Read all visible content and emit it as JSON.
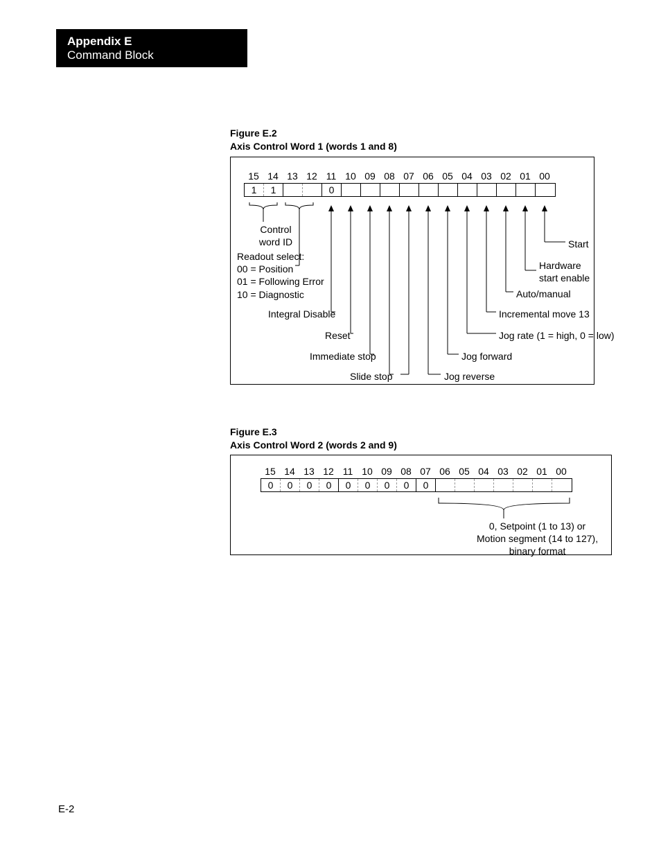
{
  "header": {
    "appendix": "Appendix E",
    "section": "Command Block"
  },
  "page_number": "E-2",
  "figE2": {
    "name": "Figure E.2",
    "title": "Axis Control Word 1 (words 1 and 8)",
    "bits": [
      "15",
      "14",
      "13",
      "12",
      "11",
      "10",
      "09",
      "08",
      "07",
      "06",
      "05",
      "04",
      "03",
      "02",
      "01",
      "00"
    ],
    "values": [
      "1",
      "1",
      "",
      "",
      "0",
      "",
      "",
      "",
      "",
      "",
      "",
      "",
      "",
      "",
      "",
      ""
    ],
    "labels": {
      "control_word_id": "Control\nword ID",
      "readout_select_title": "Readout select:",
      "readout_select_00": "00 = Position",
      "readout_select_01": "01 = Following Error",
      "readout_select_10": "10 = Diagnostic",
      "integral_disable": "Integral Disable",
      "reset": "Reset",
      "immediate_stop": "Immediate stop",
      "slide_stop": "Slide stop",
      "start": "Start",
      "hw_start_enable": "Hardware\nstart enable",
      "auto_manual": "Auto/manual",
      "inc_move_13": "Incremental move 13",
      "jog_rate": "Jog rate (1 = high, 0 = low)",
      "jog_forward": "Jog forward",
      "jog_reverse": "Jog reverse"
    }
  },
  "figE3": {
    "name": "Figure E.3",
    "title": "Axis Control Word 2 (words 2 and 9)",
    "bits": [
      "15",
      "14",
      "13",
      "12",
      "11",
      "10",
      "09",
      "08",
      "07",
      "06",
      "05",
      "04",
      "03",
      "02",
      "01",
      "00"
    ],
    "values": [
      "0",
      "0",
      "0",
      "0",
      "0",
      "0",
      "0",
      "0",
      "0",
      "",
      "",
      "",
      "",
      "",
      "",
      ""
    ],
    "labels": {
      "note": "0, Setpoint (1 to 13) or\nMotion segment (14 to 127),\nbinary format"
    }
  }
}
